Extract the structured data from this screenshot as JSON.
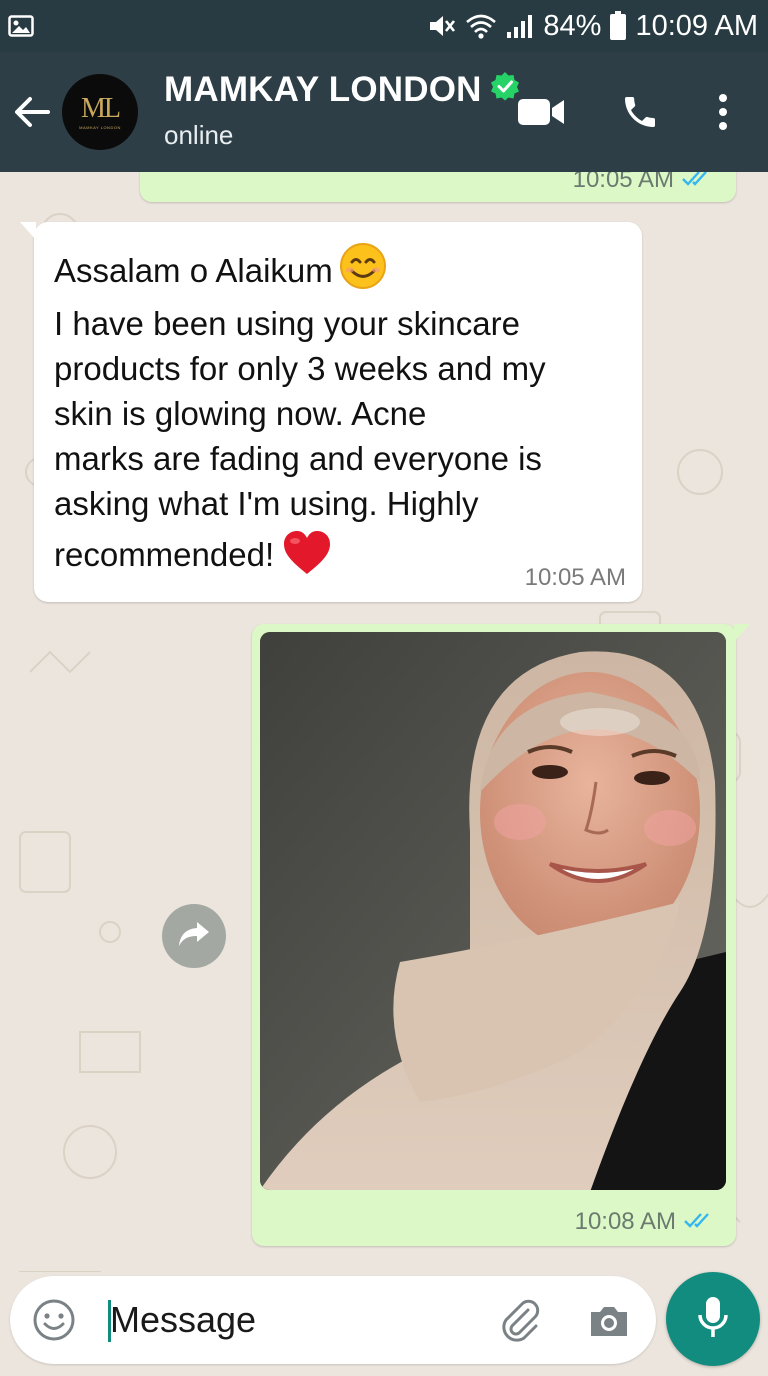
{
  "status_bar": {
    "battery": "84%",
    "time": "10:09 AM",
    "icons": [
      "image-icon",
      "mute-icon",
      "wifi-icon",
      "signal-icon",
      "battery-icon"
    ]
  },
  "header": {
    "contact_name": "MAMKAY LONDON",
    "contact_status": "online",
    "avatar_monogram": "ML",
    "avatar_tagline": "MAMKAY LONDON",
    "icons": [
      "back-arrow-icon",
      "verified-badge-icon",
      "video-call-icon",
      "phone-icon",
      "more-vert-icon"
    ]
  },
  "messages": [
    {
      "direction": "outgoing",
      "time": "10:05 AM",
      "ticks": "read"
    },
    {
      "direction": "incoming",
      "lines": [
        "Assalam o Alaikum",
        "I have been using your skincare",
        "products for only 3 weeks and my",
        "skin is glowing now. Acne",
        "marks are fading and everyone is",
        "asking what I'm using. Highly",
        "recommended!"
      ],
      "emojis": [
        "smiling-face-icon",
        "red-heart-icon"
      ],
      "time": "10:05 AM"
    },
    {
      "direction": "outgoing",
      "type": "image",
      "time": "10:08 AM",
      "ticks": "read"
    }
  ],
  "composer": {
    "placeholder": "Message",
    "icons": [
      "emoji-icon",
      "attach-icon",
      "camera-icon",
      "mic-icon"
    ]
  },
  "colors": {
    "header": "#2d3e46",
    "chat_bg": "#ece5dd",
    "outgoing_bubble": "#dcf8c6",
    "incoming_bubble": "#ffffff",
    "accent": "#128c7e",
    "read_ticks": "#34b7f1",
    "verified": "#25d366"
  }
}
